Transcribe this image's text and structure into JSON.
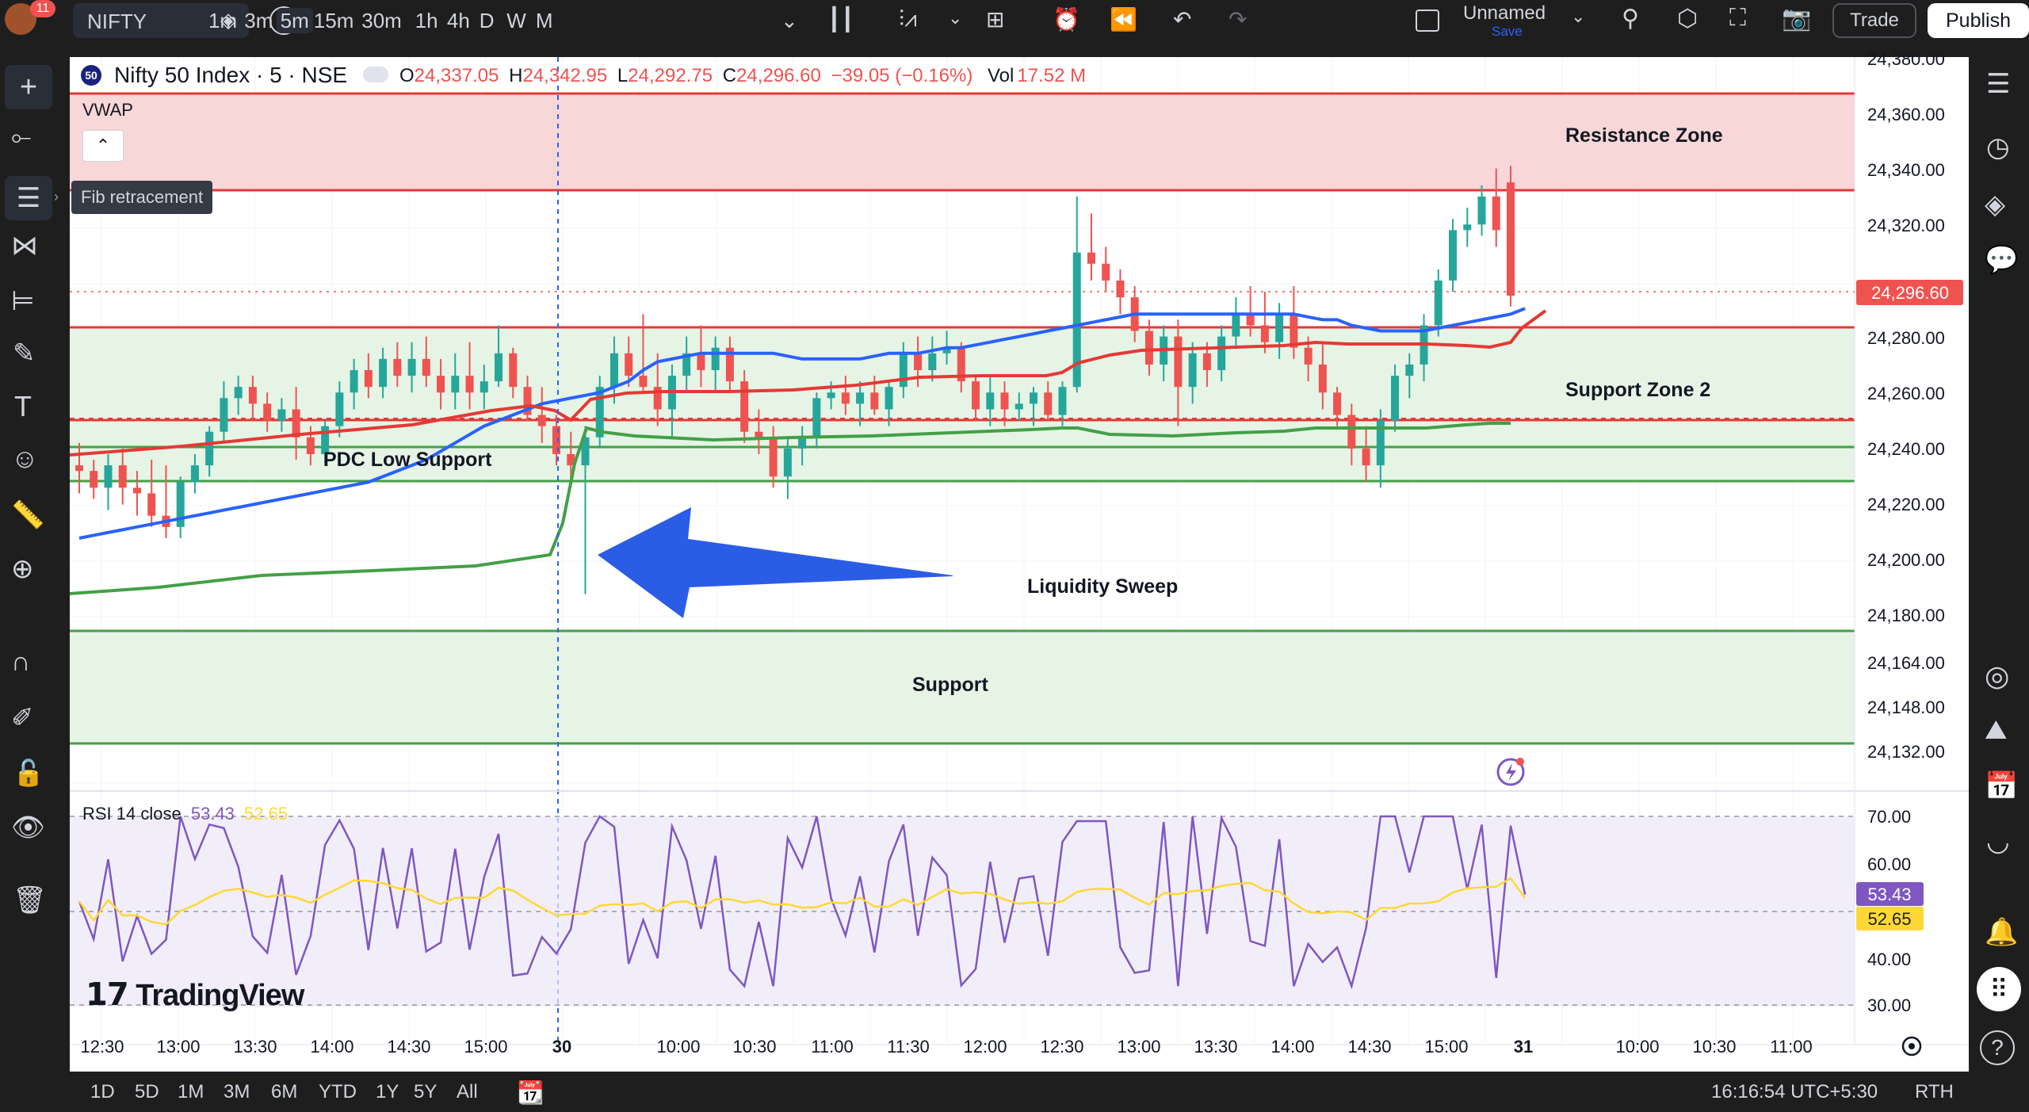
{
  "topbar": {
    "notification_count": "11",
    "symbol": "NIFTY",
    "intervals": [
      "1m",
      "3m",
      "5m",
      "15m",
      "30m",
      "1h",
      "4h",
      "D",
      "W",
      "M"
    ],
    "active_interval": "5m",
    "layout_name": "Unnamed",
    "save_label": "Save",
    "trade_label": "Trade",
    "publish_label": "Publish"
  },
  "legend": {
    "symbol_badge": "50",
    "title": "Nifty 50 Index · 5 · NSE",
    "o_label": "O",
    "o_value": "24,337.05",
    "h_label": "H",
    "h_value": "24,342.95",
    "l_label": "L",
    "l_value": "24,292.75",
    "c_label": "C",
    "c_value": "24,296.60",
    "change": "−39.05 (−0.16%)",
    "vol_label": "Vol",
    "vol_value": "17.52 M",
    "vwap_label": "VWAP",
    "tooltip": "Fib retracement"
  },
  "annotations": {
    "resistance": "Resistance Zone",
    "support2": "Support Zone 2",
    "pdc": "PDC Low Support",
    "sweep": "Liquidity Sweep",
    "support": "Support"
  },
  "rsi": {
    "label": "RSI 14 close",
    "value1": "53.43",
    "value2": "52.65",
    "ticks": [
      "70.00",
      "60.00",
      "40.00",
      "30.00"
    ]
  },
  "price_axis": {
    "ticks": [
      "24,380.00",
      "24,360.00",
      "24,340.00",
      "24,320.00",
      "24,280.00",
      "24,260.00",
      "24,240.00",
      "24,220.00",
      "24,200.00",
      "24,180.00",
      "24,164.00",
      "24,148.00",
      "24,132.00"
    ],
    "last_price": "24,296.60"
  },
  "time_axis": {
    "ticks": [
      "12:30",
      "13:00",
      "13:30",
      "14:00",
      "14:30",
      "15:00",
      "30",
      "10:00",
      "10:30",
      "11:00",
      "11:30",
      "12:00",
      "12:30",
      "13:00",
      "13:30",
      "14:00",
      "14:30",
      "15:00",
      "31",
      "10:00",
      "10:30",
      "11:00"
    ]
  },
  "bottombar": {
    "ranges": [
      "1D",
      "5D",
      "1M",
      "3M",
      "6M",
      "YTD",
      "1Y",
      "5Y",
      "All"
    ],
    "clock": "16:16:54 UTC+5:30",
    "session": "RTH"
  },
  "watermark": "TradingView",
  "colors": {
    "bg": "#ffffff",
    "dark": "#1e1e1e",
    "up": "#26a69a",
    "down": "#ef5350",
    "zone_red": "#f8d7d9",
    "zone_green": "#e6f4e6",
    "vwap_blue": "#2962ff",
    "rsi": "#7e57c2",
    "rsi_ma": "#fdd835"
  },
  "chart_data": {
    "type": "candlestick",
    "series": [
      {
        "name": "Nifty 50 Index",
        "values": [
          [
            24236,
            24244,
            24226,
            24234
          ],
          [
            24234,
            24238,
            24224,
            24228
          ],
          [
            24228,
            24240,
            24220,
            24236
          ],
          [
            24236,
            24242,
            24222,
            24228
          ],
          [
            24228,
            24234,
            24218,
            24226
          ],
          [
            24226,
            24238,
            24214,
            24218
          ],
          [
            24218,
            24236,
            24210,
            24214
          ],
          [
            24214,
            24232,
            24210,
            24230
          ],
          [
            24230,
            24240,
            24226,
            24236
          ],
          [
            24236,
            24250,
            24232,
            24248
          ],
          [
            24248,
            24266,
            24244,
            24260
          ],
          [
            24260,
            24268,
            24254,
            24264
          ],
          [
            24264,
            24268,
            24252,
            24258
          ],
          [
            24258,
            24262,
            24248,
            24252
          ],
          [
            24252,
            24260,
            24248,
            24256
          ],
          [
            24256,
            24264,
            24238,
            24246
          ],
          [
            24246,
            24250,
            24236,
            24240
          ],
          [
            24240,
            24252,
            24236,
            24250
          ],
          [
            24250,
            24266,
            24246,
            24262
          ],
          [
            24262,
            24274,
            24256,
            24270
          ],
          [
            24270,
            24276,
            24260,
            24264
          ],
          [
            24264,
            24278,
            24260,
            24274
          ],
          [
            24274,
            24280,
            24264,
            24268
          ],
          [
            24268,
            24280,
            24262,
            24274
          ],
          [
            24274,
            24282,
            24264,
            24268
          ],
          [
            24268,
            24274,
            24256,
            24262
          ],
          [
            24262,
            24276,
            24256,
            24268
          ],
          [
            24268,
            24280,
            24256,
            24262
          ],
          [
            24262,
            24272,
            24256,
            24266
          ],
          [
            24266,
            24286,
            24264,
            24276
          ],
          [
            24276,
            24278,
            24260,
            24264
          ],
          [
            24264,
            24268,
            24252,
            24254
          ],
          [
            24254,
            24264,
            24244,
            24250
          ],
          [
            24250,
            24254,
            24236,
            24240
          ],
          [
            24240,
            24248,
            24230,
            24236
          ],
          [
            24236,
            24250,
            24190,
            24246
          ],
          [
            24246,
            24268,
            24242,
            24264
          ],
          [
            24264,
            24282,
            24258,
            24276
          ],
          [
            24276,
            24282,
            24264,
            24268
          ],
          [
            24268,
            24290,
            24262,
            24264
          ],
          [
            24264,
            24276,
            24250,
            24256
          ],
          [
            24256,
            24272,
            24246,
            24268
          ],
          [
            24268,
            24282,
            24262,
            24276
          ],
          [
            24276,
            24286,
            24264,
            24270
          ],
          [
            24270,
            24282,
            24262,
            24278
          ],
          [
            24278,
            24282,
            24262,
            24266
          ],
          [
            24266,
            24270,
            24244,
            24248
          ],
          [
            24248,
            24256,
            24240,
            24246
          ],
          [
            24246,
            24250,
            24228,
            24232
          ],
          [
            24232,
            24246,
            24224,
            24242
          ],
          [
            24242,
            24250,
            24236,
            24246
          ],
          [
            24246,
            24262,
            24242,
            24260
          ],
          [
            24260,
            24266,
            24256,
            24262
          ],
          [
            24262,
            24268,
            24254,
            24258
          ],
          [
            24258,
            24266,
            24250,
            24262
          ],
          [
            24262,
            24268,
            24254,
            24256
          ],
          [
            24256,
            24266,
            24250,
            24264
          ],
          [
            24264,
            24280,
            24260,
            24276
          ],
          [
            24276,
            24282,
            24264,
            24270
          ],
          [
            24270,
            24282,
            24266,
            24276
          ],
          [
            24276,
            24284,
            24272,
            24278
          ],
          [
            24278,
            24280,
            24262,
            24266
          ],
          [
            24266,
            24268,
            24252,
            24256
          ],
          [
            24256,
            24268,
            24250,
            24262
          ],
          [
            24262,
            24266,
            24250,
            24256
          ],
          [
            24256,
            24262,
            24252,
            24258
          ],
          [
            24258,
            24264,
            24250,
            24262
          ],
          [
            24262,
            24266,
            24252,
            24254
          ],
          [
            24254,
            24266,
            24250,
            24264
          ],
          [
            24264,
            24332,
            24262,
            24312
          ],
          [
            24312,
            24326,
            24302,
            24308
          ],
          [
            24308,
            24314,
            24298,
            24302
          ],
          [
            24302,
            24306,
            24290,
            24296
          ],
          [
            24296,
            24300,
            24280,
            24284
          ],
          [
            24284,
            24288,
            24268,
            24272
          ],
          [
            24272,
            24286,
            24266,
            24282
          ],
          [
            24282,
            24288,
            24250,
            24264
          ],
          [
            24264,
            24280,
            24258,
            24276
          ],
          [
            24276,
            24280,
            24264,
            24270
          ],
          [
            24270,
            24286,
            24266,
            24282
          ],
          [
            24282,
            24296,
            24278,
            24290
          ],
          [
            24290,
            24300,
            24282,
            24286
          ],
          [
            24286,
            24298,
            24276,
            24280
          ],
          [
            24280,
            24294,
            24274,
            24290
          ],
          [
            24290,
            24300,
            24274,
            24278
          ],
          [
            24278,
            24282,
            24266,
            24272
          ],
          [
            24272,
            24280,
            24256,
            24262
          ],
          [
            24262,
            24264,
            24250,
            24254
          ],
          [
            24254,
            24258,
            24236,
            24242
          ],
          [
            24242,
            24250,
            24230,
            24236
          ],
          [
            24236,
            24256,
            24228,
            24252
          ],
          [
            24252,
            24272,
            24248,
            24268
          ],
          [
            24268,
            24276,
            24260,
            24272
          ],
          [
            24272,
            24290,
            24266,
            24286
          ],
          [
            24286,
            24306,
            24282,
            24302
          ],
          [
            24302,
            24324,
            24298,
            24320
          ],
          [
            24320,
            24328,
            24314,
            24322
          ],
          [
            24322,
            24336,
            24318,
            24332
          ],
          [
            24332,
            24342,
            24314,
            24320
          ],
          [
            24337.05,
            24342.95,
            24292.75,
            24296.6
          ]
        ]
      }
    ],
    "vwap": [
      24210,
      24211,
      24212,
      24213,
      24214,
      24215,
      24216,
      24217,
      24218,
      24219,
      24220,
      24221,
      24222,
      24223,
      24224,
      24225,
      24226,
      24227,
      24228,
      24229,
      24230,
      24232,
      24234,
      24236,
      24238,
      24241,
      24244,
      24247,
      24250,
      24252,
      24254,
      24256,
      24258,
      24259,
      24260,
      24261,
      24262,
      24264,
      24266,
      24270,
      24273,
      24274,
      24275,
      24276,
      24276,
      24276,
      24276,
      24276,
      24276,
      24275,
      24274,
      24274,
      24274,
      24274,
      24274,
      24275,
      24276,
      24276,
      24276,
      24277,
      24278,
      24278,
      24279,
      24280,
      24281,
      24282,
      24283,
      24284,
      24285,
      24286,
      24287,
      24288,
      24289,
      24290,
      24290,
      24290,
      24290,
      24290,
      24290,
      24290,
      24290,
      24290,
      24290,
      24290,
      24290,
      24289,
      24288,
      24288,
      24286,
      24285,
      24284,
      24284,
      24284,
      24284,
      24285,
      24286,
      24287,
      24288,
      24289,
      24290,
      24292
    ],
    "ylim_price": [
      24120,
      24384
    ],
    "rsi": {
      "ylim": [
        28,
        72
      ]
    }
  }
}
